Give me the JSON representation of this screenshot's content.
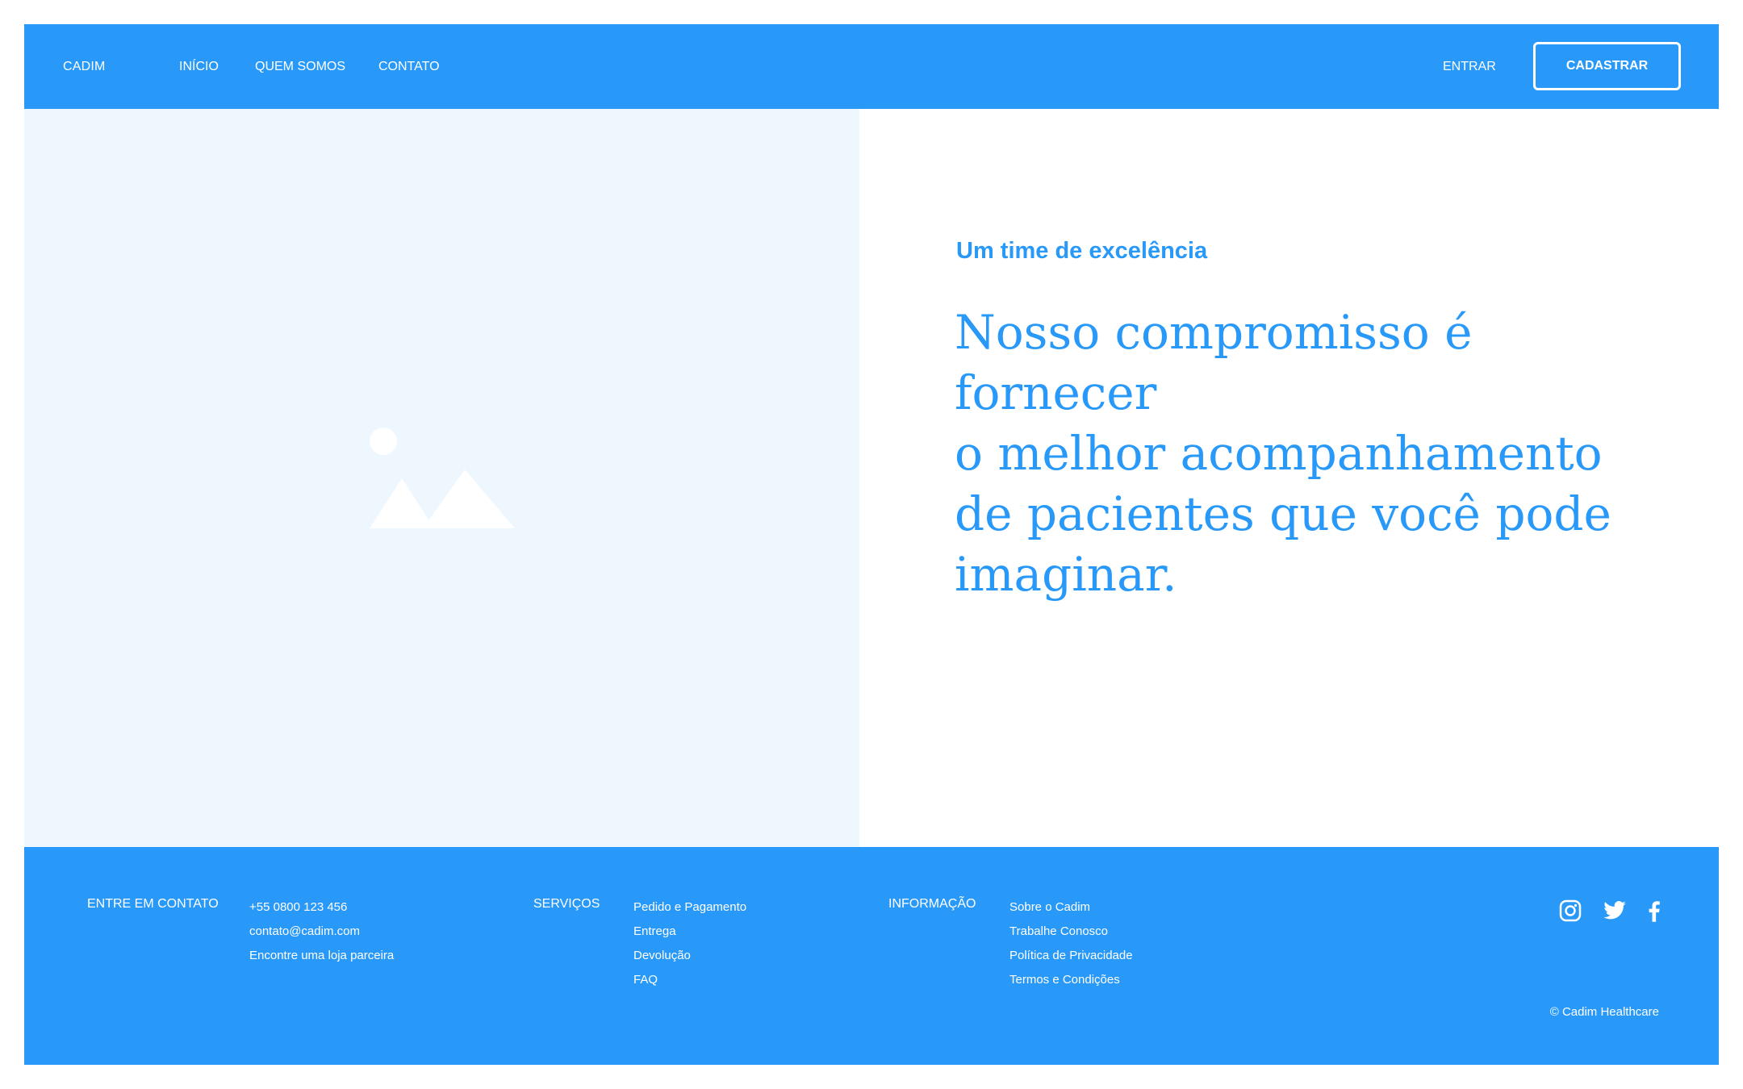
{
  "header": {
    "brand": "CADIM",
    "nav": [
      "INÍCIO",
      "QUEM SOMOS",
      "CONTATO"
    ],
    "login_label": "ENTRAR",
    "signup_label": "CADASTRAR"
  },
  "hero": {
    "eyebrow": "Um time de excelência",
    "headline_lines": [
      "Nosso compromisso é fornecer",
      "o melhor acompanhamento",
      "de pacientes que você pode",
      "imaginar."
    ],
    "image_icon": "image-placeholder-icon"
  },
  "footer": {
    "contact_heading": "ENTRE EM CONTATO",
    "contact_items": [
      "+55 0800 123 456",
      "contato@cadim.com",
      "Encontre uma loja parceira"
    ],
    "services_heading": "SERVIÇOS",
    "services_items": [
      "Pedido e Pagamento",
      "Entrega",
      "Devolução",
      "FAQ"
    ],
    "info_heading": "INFORMAÇÃO",
    "info_items": [
      "Sobre o Cadim",
      "Trabalhe Conosco",
      "Política de Privacidade",
      "Termos e Condições"
    ],
    "social_icons": [
      "instagram-icon",
      "twitter-icon",
      "facebook-icon"
    ],
    "copyright": "© Cadim Healthcare"
  },
  "colors": {
    "primary": "#2899f8",
    "image_panel": "#eff7fe",
    "text_on_primary": "#ffffff"
  }
}
